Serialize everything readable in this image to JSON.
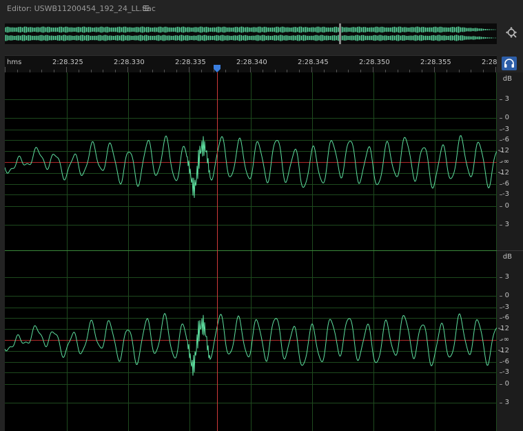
{
  "editor": {
    "title": "Editor: USWB11200454_192_24_LL.flac",
    "menu_icon": "hamburger-menu-icon"
  },
  "overview": {
    "playhead_position": 0.68
  },
  "icons": {
    "zoom": "zoom-to-selection-icon",
    "snap": "headphones-snap-icon"
  },
  "ruler": {
    "unit_label": "hms",
    "ticks": [
      "2:28.325",
      "2:28.330",
      "2:28.335",
      "2:28.340",
      "2:28.345",
      "2:28.350",
      "2:28.355",
      "2:28"
    ]
  },
  "channels": [
    {
      "unit": "dB",
      "labels": [
        "3",
        "0",
        "-3",
        "-6",
        "-12",
        "-∞",
        "-12",
        "-6",
        "-3",
        "0",
        "3"
      ]
    },
    {
      "unit": "dB",
      "labels": [
        "3",
        "0",
        "-3",
        "-6",
        "-12",
        "-∞",
        "-12",
        "-6",
        "-3",
        "0",
        "3"
      ]
    }
  ],
  "colors": {
    "waveform": "#5ee0a0",
    "overview_wave": "#55d39a",
    "grid": "#1e4a1e",
    "center_line": "#b02828",
    "playhead": "#d03a3a",
    "marker": "#3b7fe0",
    "background": "#000000",
    "panel": "#232323"
  }
}
